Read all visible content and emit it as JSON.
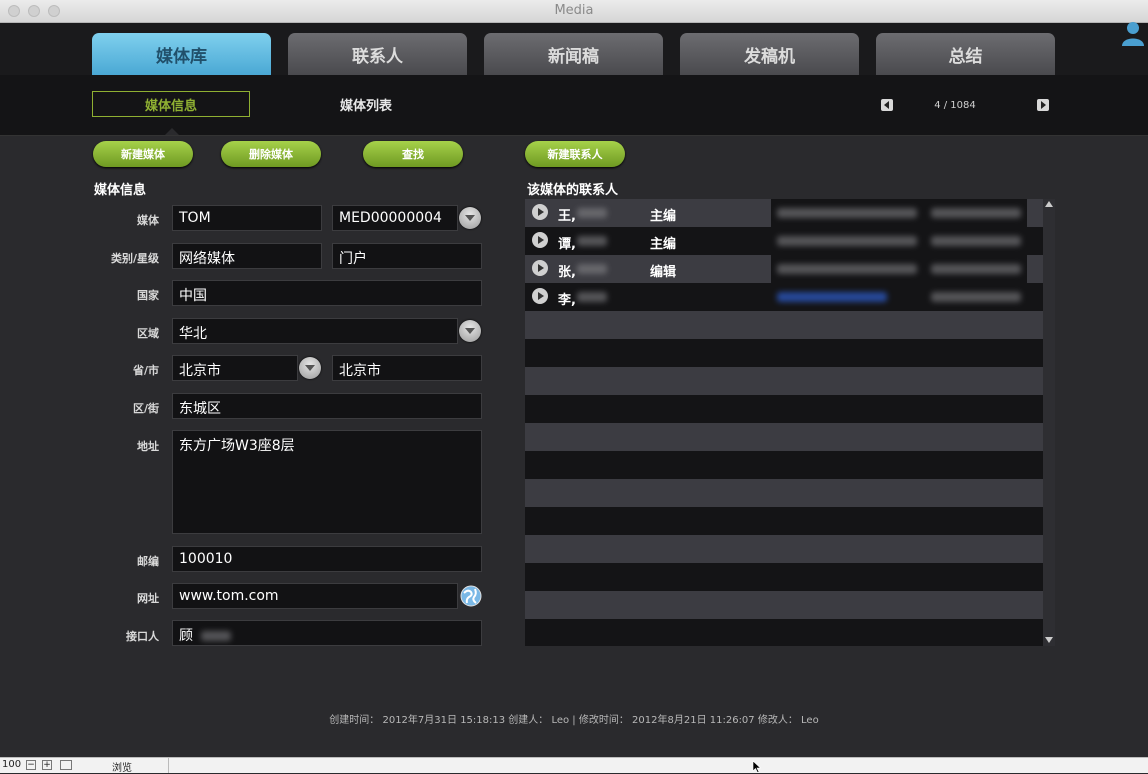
{
  "window": {
    "title": "Media"
  },
  "tabs": [
    {
      "label": "媒体库",
      "active": true
    },
    {
      "label": "联系人",
      "active": false
    },
    {
      "label": "新闻稿",
      "active": false
    },
    {
      "label": "发稿机",
      "active": false
    },
    {
      "label": "总结",
      "active": false
    }
  ],
  "subnav": {
    "info_label": "媒体信息",
    "list_label": "媒体列表",
    "pager": "4 / 1084"
  },
  "actions": {
    "new_media": "新建媒体",
    "delete_media": "删除媒体",
    "find": "查找",
    "new_contact": "新建联系人"
  },
  "media_info": {
    "section_title": "媒体信息",
    "labels": {
      "media": "媒体",
      "category": "类别/星级",
      "country": "国家",
      "region": "区域",
      "province": "省/市",
      "district": "区/街",
      "address": "地址",
      "postcode": "邮编",
      "website": "网址",
      "contact_person": "接口人"
    },
    "values": {
      "media_name": "TOM",
      "media_id": "MED00000004",
      "category": "网络媒体",
      "star": "门户",
      "country": "中国",
      "region": "华北",
      "province": "北京市",
      "city": "北京市",
      "district": "东城区",
      "address": "东方广场W3座8层",
      "postcode": "100010",
      "website": "www.tom.com",
      "contact_person": "顾"
    }
  },
  "contacts": {
    "section_title": "该媒体的联系人",
    "rows": [
      {
        "name": "王,",
        "title": "主编"
      },
      {
        "name": "谭,",
        "title": "主编"
      },
      {
        "name": "张,",
        "title": "编辑"
      },
      {
        "name": "李,",
        "title": ""
      }
    ]
  },
  "footer": {
    "meta": "创建时间： 2012年7月31日  15:18:13 创建人： Leo | 修改时间： 2012年8月21日  11:26:07 修改人： Leo"
  },
  "statusbar": {
    "zoom": "100",
    "mode": "浏览"
  },
  "colors": {
    "accent_blue": "#5ab4dc",
    "accent_green": "#8fb032",
    "background": "#2a2a2d"
  }
}
